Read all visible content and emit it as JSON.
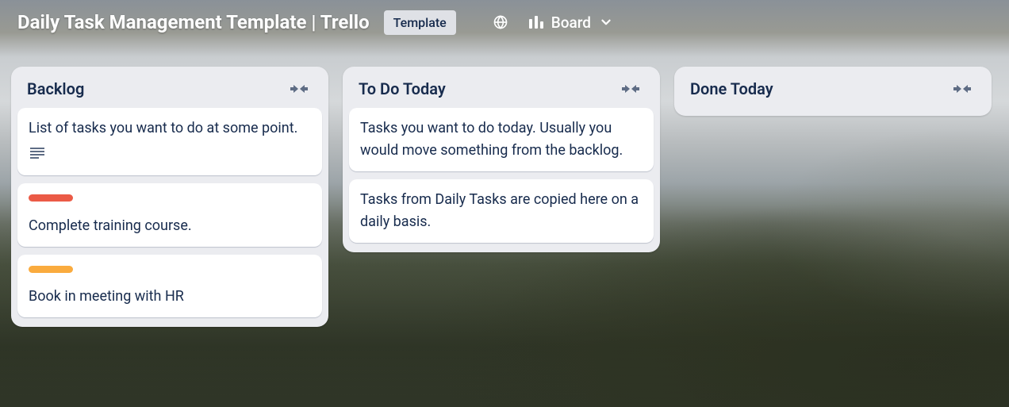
{
  "header": {
    "title": "Daily Task Management Template | Trello",
    "template_badge": "Template",
    "view_label": "Board"
  },
  "lists": [
    {
      "title": "Backlog",
      "cards": [
        {
          "text": "List of tasks you want to do at some point.",
          "has_description": true
        },
        {
          "text": "Complete training course.",
          "label_color": "red"
        },
        {
          "text": "Book in meeting with HR",
          "label_color": "orange"
        }
      ]
    },
    {
      "title": "To Do Today",
      "cards": [
        {
          "text": "Tasks you want to do today. Usually you would move something from the backlog."
        },
        {
          "text": "Tasks from Daily Tasks are copied here on a daily basis."
        }
      ]
    },
    {
      "title": "Done Today",
      "cards": []
    }
  ],
  "colors": {
    "red": "#eb5a46",
    "orange": "#faab3e"
  }
}
